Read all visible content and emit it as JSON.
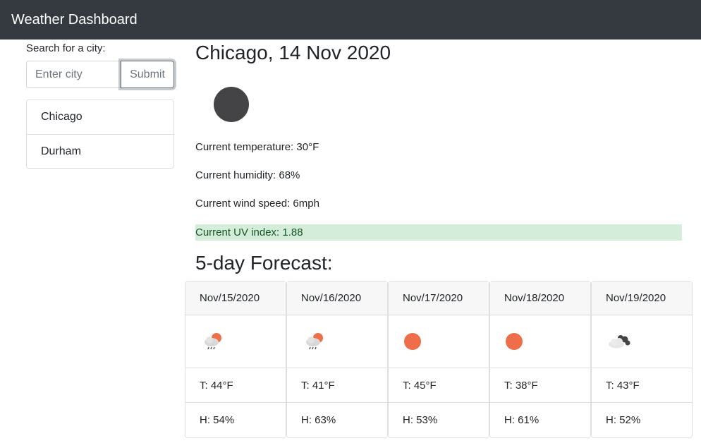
{
  "app": {
    "title": "Weather Dashboard"
  },
  "search": {
    "label": "Search for a city:",
    "placeholder": "Enter city",
    "value": "",
    "submit_label": "Submit"
  },
  "history": [
    {
      "label": "Chicago"
    },
    {
      "label": "Durham"
    }
  ],
  "current": {
    "heading": "Chicago, 14 Nov 2020",
    "icon": "dark-sun-icon",
    "temperature": "Current temperature: 30°F",
    "humidity": "Current humidity: 68%",
    "wind": "Current wind speed: 6mph",
    "uv": "Current UV index: 1.88",
    "uv_color": "#d4edda"
  },
  "forecast": {
    "heading": "5-day Forecast:",
    "days": [
      {
        "date": "Nov/15/2020",
        "icon": "rain-cloud-sun-icon",
        "temp": "T: 44°F",
        "humidity": "H: 54%"
      },
      {
        "date": "Nov/16/2020",
        "icon": "rain-cloud-sun-icon",
        "temp": "T: 41°F",
        "humidity": "H: 63%"
      },
      {
        "date": "Nov/17/2020",
        "icon": "sun-icon",
        "temp": "T: 45°F",
        "humidity": "H: 53%"
      },
      {
        "date": "Nov/18/2020",
        "icon": "sun-icon",
        "temp": "T: 38°F",
        "humidity": "H: 61%"
      },
      {
        "date": "Nov/19/2020",
        "icon": "cloud-icon",
        "temp": "T: 43°F",
        "humidity": "H: 52%"
      }
    ]
  },
  "colors": {
    "navbar": "#343a40",
    "sun": "#ee6e4a",
    "uv_background": "#d4edda",
    "uv_text": "#155724"
  }
}
